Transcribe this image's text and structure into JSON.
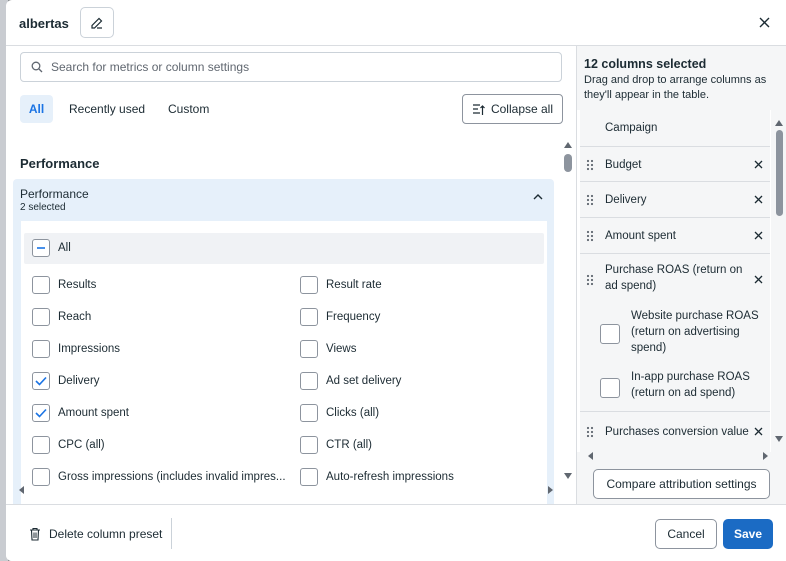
{
  "header": {
    "title": "albertas"
  },
  "search": {
    "placeholder": "Search for metrics or column settings"
  },
  "tabs": [
    {
      "label": "All",
      "active": true
    },
    {
      "label": "Recently used",
      "active": false
    },
    {
      "label": "Custom",
      "active": false
    }
  ],
  "collapse_label": "Collapse all",
  "section_heading": "Performance",
  "group": {
    "title": "Performance",
    "subtitle": "2 selected",
    "all_label": "All",
    "items": [
      {
        "label": "Results",
        "checked": false
      },
      {
        "label": "Result rate",
        "checked": false
      },
      {
        "label": "Reach",
        "checked": false
      },
      {
        "label": "Frequency",
        "checked": false
      },
      {
        "label": "Impressions",
        "checked": false
      },
      {
        "label": "Views",
        "checked": false
      },
      {
        "label": "Delivery",
        "checked": true
      },
      {
        "label": "Ad set delivery",
        "checked": false
      },
      {
        "label": "Amount spent",
        "checked": true
      },
      {
        "label": "Clicks (all)",
        "checked": false
      },
      {
        "label": "CPC (all)",
        "checked": false
      },
      {
        "label": "CTR (all)",
        "checked": false
      },
      {
        "label": "Gross impressions (includes invalid impres...",
        "checked": false
      },
      {
        "label": "Auto-refresh impressions",
        "checked": false
      }
    ]
  },
  "right_panel": {
    "title": "12 columns selected",
    "description": "Drag and drop to arrange columns as they'll appear in the table.",
    "columns": [
      {
        "label": "Campaign"
      },
      {
        "label": "Budget"
      },
      {
        "label": "Delivery"
      },
      {
        "label": "Amount spent"
      },
      {
        "label": "Purchase ROAS (return on ad spend)"
      },
      {
        "label": "Purchases conversion value"
      }
    ],
    "sub_options": [
      {
        "label": "Website purchase ROAS (return on advertising spend)",
        "checked": false
      },
      {
        "label": "In-app purchase ROAS (return on ad spend)",
        "checked": false
      }
    ],
    "compare_label": "Compare attribution settings"
  },
  "footer": {
    "delete_label": "Delete column preset",
    "cancel_label": "Cancel",
    "save_label": "Save"
  },
  "colors": {
    "accent": "#1b74e4",
    "save_bg": "#1b6bc4",
    "panel_blue": "#e6f0fa"
  },
  "icons": [
    "edit-icon",
    "close-icon",
    "search-icon",
    "collapse-icon",
    "chevron-up-icon",
    "drag-handle-icon",
    "remove-icon",
    "trash-icon",
    "check-icon",
    "minus-icon"
  ]
}
